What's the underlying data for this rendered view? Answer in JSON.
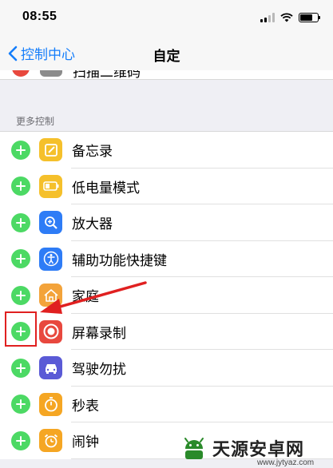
{
  "status_bar": {
    "time": "08:55"
  },
  "nav": {
    "back_label": "控制中心",
    "title": "自定"
  },
  "partial_row": {
    "label": "扫描二维码"
  },
  "section": {
    "header": "更多控制"
  },
  "items": [
    {
      "label": "备忘录",
      "icon": "notes-icon",
      "color": "#f5c02b"
    },
    {
      "label": "低电量模式",
      "icon": "battery-icon",
      "color": "#f5c02b"
    },
    {
      "label": "放大器",
      "icon": "magnifier-icon",
      "color": "#2e7cf6"
    },
    {
      "label": "辅助功能快捷键",
      "icon": "accessibility-icon",
      "color": "#2e7cf6"
    },
    {
      "label": "家庭",
      "icon": "home-icon",
      "color": "#f3a33a"
    },
    {
      "label": "屏幕录制",
      "icon": "screen-record-icon",
      "color": "#e8483e"
    },
    {
      "label": "驾驶勿扰",
      "icon": "car-icon",
      "color": "#5a5ad6"
    },
    {
      "label": "秒表",
      "icon": "stopwatch-icon",
      "color": "#f5a623"
    },
    {
      "label": "闹钟",
      "icon": "alarm-icon",
      "color": "#f5a623"
    }
  ],
  "watermark": {
    "brand": "天源安卓网",
    "url": "www.jytyaz.com"
  },
  "colors": {
    "accent": "#157efb",
    "add": "#4cd964",
    "annotation": "#e02020"
  }
}
